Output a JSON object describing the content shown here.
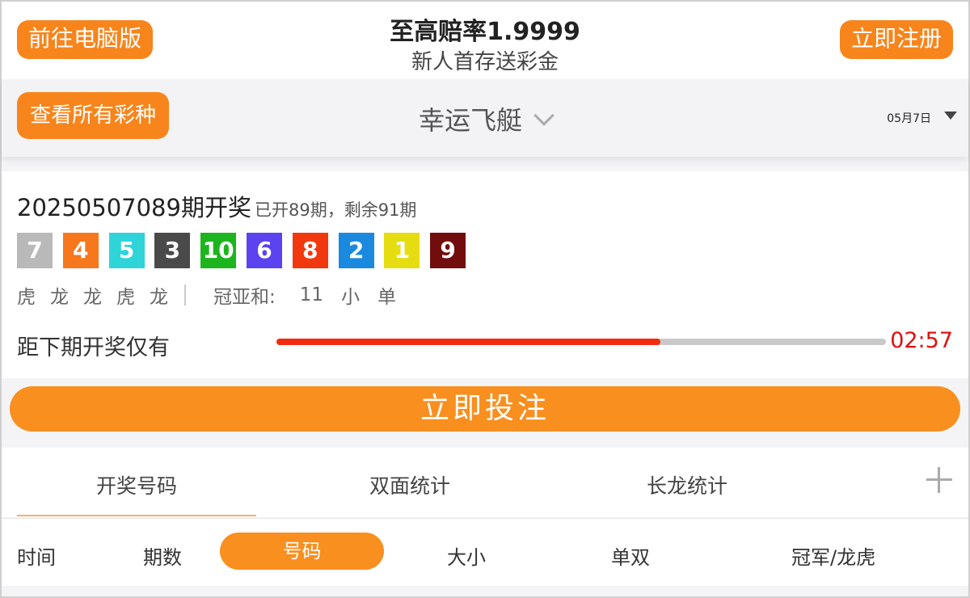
{
  "header": {
    "pc_button": "前往电脑版",
    "title": "至高赔率1.9999",
    "subtitle": "新人首存送彩金",
    "register_button": "立即注册"
  },
  "lottery_bar": {
    "all_button": "查看所有彩种",
    "name": "幸运飞艇",
    "date": "05月7日"
  },
  "draw": {
    "issue_title": "20250507089期开奖",
    "issue_stat": "已开89期，剩余91期",
    "balls": [
      {
        "num": "7",
        "color": "#b9b9b9"
      },
      {
        "num": "4",
        "color": "#f7771c"
      },
      {
        "num": "5",
        "color": "#2fd4d9"
      },
      {
        "num": "3",
        "color": "#4a4a4a"
      },
      {
        "num": "10",
        "color": "#1db51d"
      },
      {
        "num": "6",
        "color": "#5b43f0"
      },
      {
        "num": "8",
        "color": "#f2380f"
      },
      {
        "num": "2",
        "color": "#1a8ae0"
      },
      {
        "num": "1",
        "color": "#e6dd10"
      },
      {
        "num": "9",
        "color": "#720d0d"
      }
    ],
    "dragon_tiger": [
      "虎",
      "龙",
      "龙",
      "虎",
      "龙"
    ],
    "sum_label": "冠亚和:",
    "sum_value": "11",
    "sum_size": "小",
    "sum_parity": "单",
    "countdown_label": "距下期开奖仅有",
    "countdown_progress": 0.63,
    "timer": "02:57"
  },
  "bet_button": "立即投注",
  "tabs": [
    "开奖号码",
    "双面统计",
    "长龙统计"
  ],
  "columns": {
    "time": "时间",
    "issue": "期数",
    "number": "号码",
    "size": "大小",
    "parity": "单双",
    "champion": "冠军/龙虎"
  }
}
